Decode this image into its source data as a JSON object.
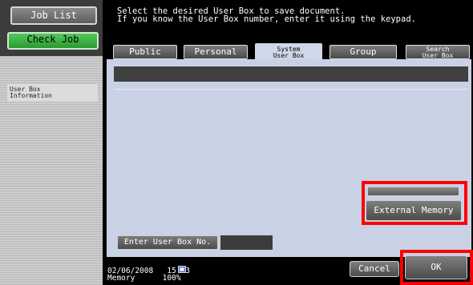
{
  "sidebar": {
    "job_list_label": "Job List",
    "check_job_label": "Check Job",
    "info_label_line1": "User Box",
    "info_label_line2": "Information"
  },
  "header": {
    "line1": "Select the desired User Box to save document.",
    "line2": "If you know the User Box number, enter it using the keypad."
  },
  "tabs": [
    {
      "label": "Public"
    },
    {
      "label": "Personal"
    },
    {
      "label_line1": "System",
      "label_line2": "User Box",
      "active": true
    },
    {
      "label": "Group"
    },
    {
      "label_line1": "Search",
      "label_line2": "User Box"
    }
  ],
  "main": {
    "external_memory_label": "External Memory",
    "enter_box_label": "Enter User Box No.",
    "enter_box_value": ""
  },
  "status": {
    "date": "02/06/2008",
    "time": "15:33",
    "memory_label": "Memory",
    "memory_value": "100%"
  },
  "actions": {
    "cancel_label": "Cancel",
    "ok_label": "OK"
  },
  "colors": {
    "content_bg": "#c9d1e4",
    "check_job_green": "#2a9a31",
    "highlight_red": "#ff0000"
  }
}
